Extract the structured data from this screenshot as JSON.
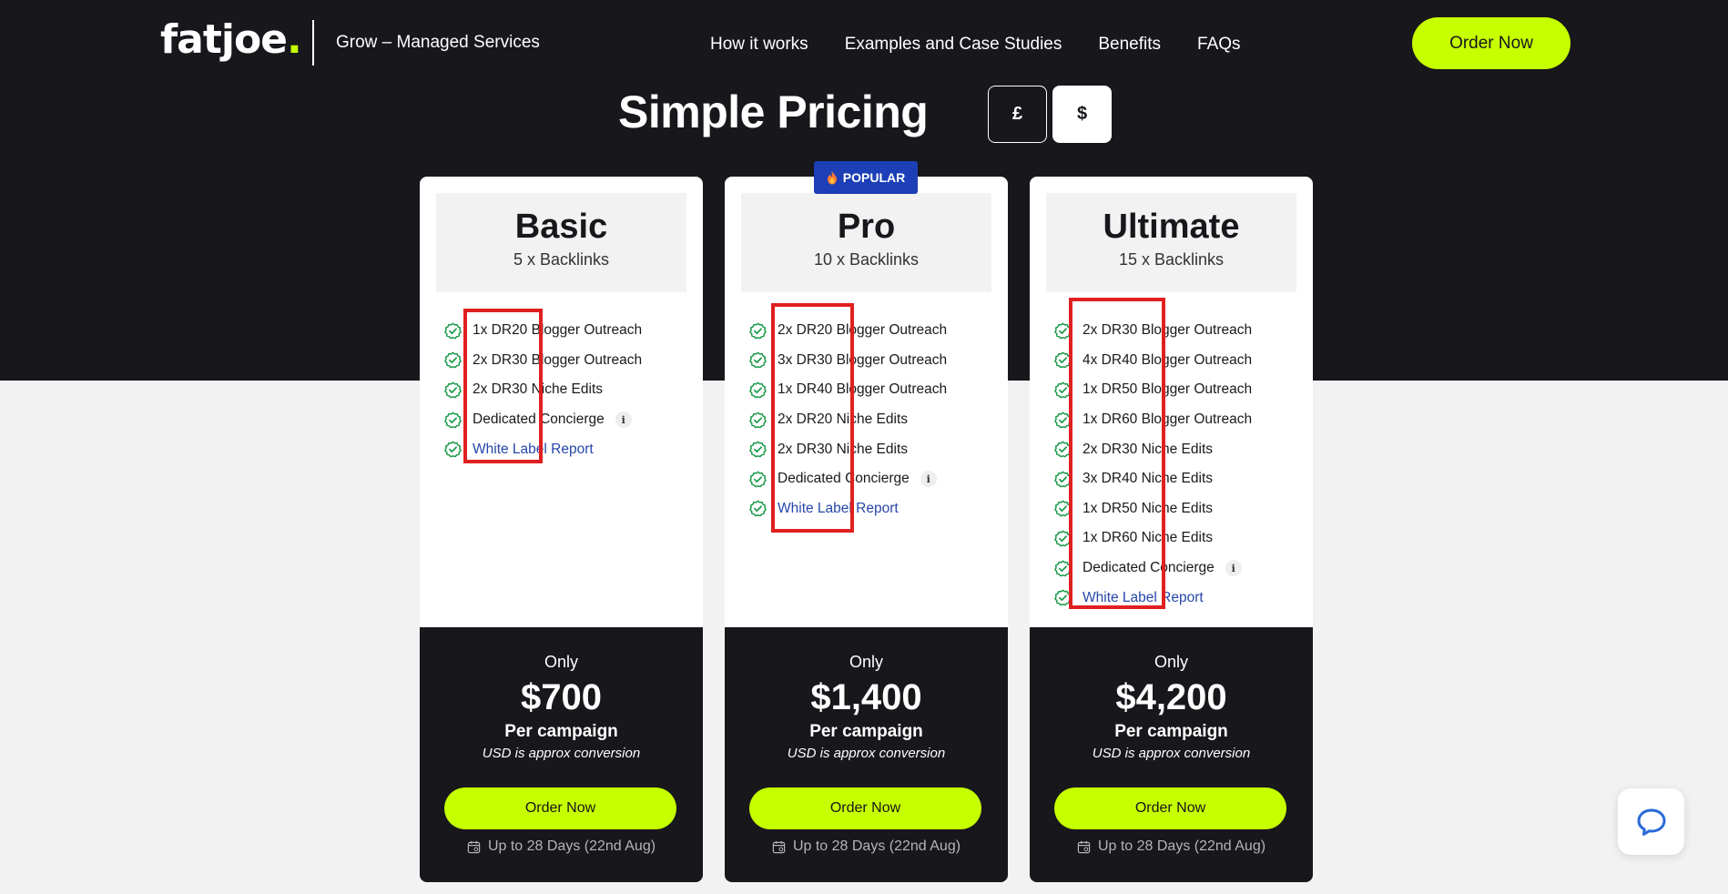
{
  "header": {
    "logo": {
      "text": "fatjoe",
      "dot": "."
    },
    "tagline": "Grow – Managed Services",
    "nav": [
      "How it works",
      "Examples and Case Studies",
      "Benefits",
      "FAQs"
    ],
    "order_label": "Order Now"
  },
  "pricing": {
    "title": "Simple Pricing",
    "currencies": [
      "£",
      "$"
    ],
    "selected_currency": "$",
    "popular_label": "POPULAR"
  },
  "plans": [
    {
      "name": "Basic",
      "subtitle": "5 x Backlinks",
      "features": [
        "1x DR20 Blogger Outreach",
        "2x DR30 Blogger Outreach",
        "2x DR30 Niche Edits",
        "Dedicated Concierge",
        "White Label Report"
      ],
      "price_prefix": "Only",
      "price": "$700",
      "price_unit": "Per campaign",
      "note": "USD is approx conversion",
      "order_label": "Order Now",
      "delivery": "Up to 28 Days (22nd Aug)"
    },
    {
      "name": "Pro",
      "subtitle": "10 x Backlinks",
      "features": [
        "2x DR20 Blogger Outreach",
        "3x DR30 Blogger Outreach",
        "1x DR40 Blogger Outreach",
        "2x DR20 Niche Edits",
        "2x DR30 Niche Edits",
        "Dedicated Concierge",
        "White Label Report"
      ],
      "price_prefix": "Only",
      "price": "$1,400",
      "price_unit": "Per campaign",
      "note": "USD is approx conversion",
      "order_label": "Order Now",
      "delivery": "Up to 28 Days (22nd Aug)"
    },
    {
      "name": "Ultimate",
      "subtitle": "15 x Backlinks",
      "features": [
        "2x DR30 Blogger Outreach",
        "4x DR40 Blogger Outreach",
        "1x DR50 Blogger Outreach",
        "1x DR60 Blogger Outreach",
        "2x DR30 Niche Edits",
        "3x DR40 Niche Edits",
        "1x DR50 Niche Edits",
        "1x DR60 Niche Edits",
        "Dedicated Concierge",
        "White Label Report"
      ],
      "price_prefix": "Only",
      "price": "$4,200",
      "price_unit": "Per campaign",
      "note": "USD is approx conversion",
      "order_label": "Order Now",
      "delivery": "Up to 28 Days (22nd Aug)"
    }
  ],
  "icons": {
    "check": "check-circle-icon",
    "info": "info-icon",
    "calendar": "calendar-icon",
    "chat": "chat-bubble-icon",
    "flame": "flame-icon"
  },
  "colors": {
    "accent": "#c6ff00",
    "dark": "#17171c",
    "badge": "#1c3fb7",
    "link": "#2646a8",
    "check": "#1a9a4a",
    "annotation": "#e02020"
  }
}
